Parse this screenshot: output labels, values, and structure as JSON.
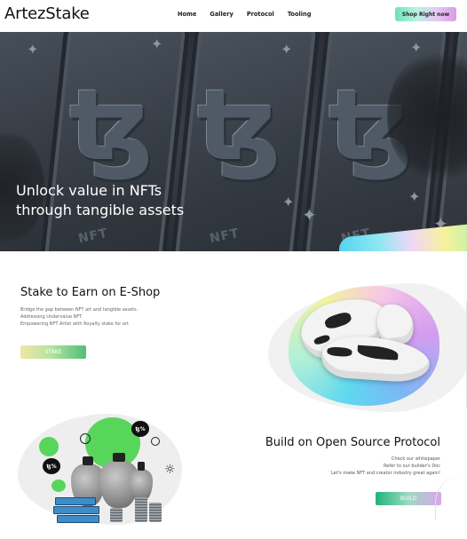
{
  "brand": {
    "logo": "ArtezStake"
  },
  "nav": {
    "items": [
      {
        "label": "Home"
      },
      {
        "label": "Gallery"
      },
      {
        "label": "Protocol"
      },
      {
        "label": "Tooling"
      }
    ],
    "cta_label": "Shop Right now"
  },
  "hero": {
    "title_line1": "Unlock value in NFTs",
    "title_line2": "through tangible assets",
    "card_glyph": "ꜩ",
    "card_marks": [
      "NFT",
      "NFT",
      "NFT"
    ]
  },
  "section_stake": {
    "title": "Stake to Earn on E-Shop",
    "lines": [
      "Bridge the gap between NFT art and tangible assets.",
      "Addressing Undervalue NFT",
      "Empowering NFT Artist with Royalty stake for art"
    ],
    "button_label": "STAKE"
  },
  "section_build": {
    "title": "Build on Open Source Protocol",
    "lines": [
      "Check our whitepaper",
      "Refer to our builder's Doc",
      "Let's make NFT and creator industry great again!"
    ],
    "button_label": "BUILD",
    "bubbles": [
      "ꜩ%",
      "ꜩ%"
    ]
  },
  "colors": {
    "hero_bg": "#2b2f35",
    "stake_gradient_end": "#4fbf7b",
    "build_gradient_start": "#20b37a",
    "build_gradient_end": "#d8a6ea"
  }
}
